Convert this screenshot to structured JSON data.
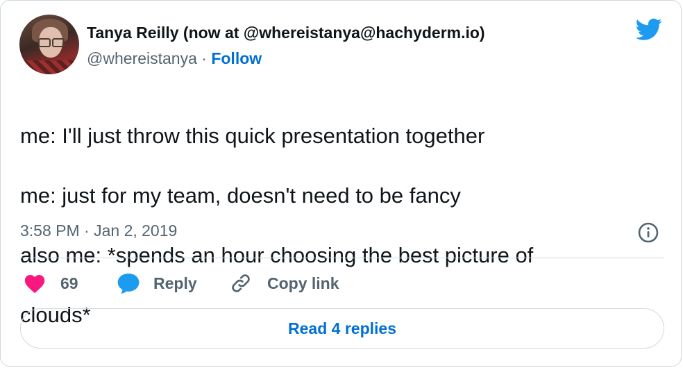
{
  "author": {
    "name": "Tanya Reilly (now at @whereistanya@hachyderm.io)",
    "handle": "@whereistanya",
    "separator": "·",
    "follow_label": "Follow"
  },
  "tweet": {
    "lines": [
      "me: I'll just throw this quick presentation together",
      "me: just for my team, doesn't need to be fancy",
      "also me: *spends an hour choosing the best picture of",
      "clouds*"
    ],
    "timestamp": "3:58 PM · Jan 2, 2019"
  },
  "actions": {
    "like_count": "69",
    "reply_label": "Reply",
    "copy_link_label": "Copy link"
  },
  "footer": {
    "read_replies_label": "Read 4 replies"
  },
  "icons": {
    "brand": "twitter-bird-icon",
    "info": "info-icon",
    "like": "heart-icon",
    "reply": "speech-bubble-icon",
    "copy": "link-icon"
  },
  "colors": {
    "brand_blue": "#1d9bf0",
    "link_blue": "#006fd6",
    "like_pink": "#f91880",
    "text_secondary": "#536471",
    "border": "#cfd9de"
  }
}
